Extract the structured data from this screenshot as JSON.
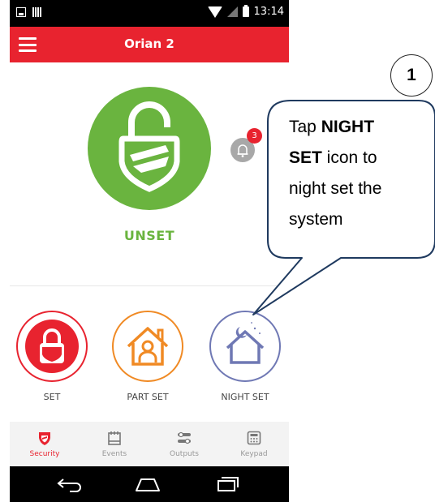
{
  "status_bar": {
    "time": "13:14"
  },
  "app_bar": {
    "title": "Orian 2"
  },
  "system": {
    "state": "UNSET",
    "notification_count": "3"
  },
  "arm_buttons": [
    {
      "label": "SET"
    },
    {
      "label": "PART SET"
    },
    {
      "label": "NIGHT SET"
    }
  ],
  "tabs": [
    {
      "label": "Security",
      "icon": "shield-icon",
      "active": true
    },
    {
      "label": "Events",
      "icon": "calendar-icon",
      "active": false
    },
    {
      "label": "Outputs",
      "icon": "toggles-icon",
      "active": false
    },
    {
      "label": "Keypad",
      "icon": "keypad-icon",
      "active": false
    }
  ],
  "callout": {
    "step_number": "1",
    "text_prefix": "Tap ",
    "text_bold_1": "NIGHT",
    "text_bold_2": "SET",
    "text_suffix_1": " icon to",
    "text_line_3": "night set the",
    "text_line_4": "system"
  },
  "colors": {
    "brand_red": "#e8232f",
    "unset_green": "#6ab43f",
    "part_set_orange": "#f08a24",
    "night_set_purple": "#6f78b4"
  }
}
